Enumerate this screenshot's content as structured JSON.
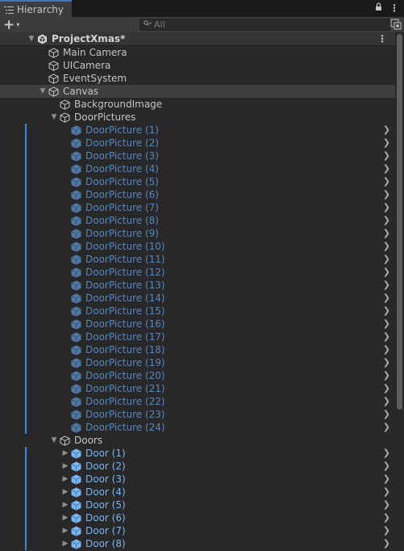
{
  "window": {
    "tab_label": "Hierarchy",
    "tab_icon": "hierarchy-list-icon",
    "lock_icon": "lock-icon",
    "menu_icon": "kebab-menu-icon"
  },
  "toolbar": {
    "add_button_label": "+",
    "add_button_caret": "▾",
    "search_placeholder": "All",
    "search_value": "",
    "scene_visibility_icon": "scene-visibility-icon"
  },
  "scene": {
    "name": "ProjectXmas*",
    "menu": "⋮"
  },
  "colors": {
    "prefab_blue": "#7cb4f0",
    "prefab_inactive": "#5b86b6",
    "prefab_bar": "#2a8be6",
    "tab_accent": "#3a79bb"
  },
  "tree": [
    {
      "label": "Main Camera",
      "depth": 1,
      "kind": "gameobject",
      "fold": "none"
    },
    {
      "label": "UICamera",
      "depth": 1,
      "kind": "gameobject",
      "fold": "none"
    },
    {
      "label": "EventSystem",
      "depth": 1,
      "kind": "gameobject",
      "fold": "none"
    },
    {
      "label": "Canvas",
      "depth": 1,
      "kind": "gameobject",
      "fold": "open",
      "hover": true
    },
    {
      "label": "BackgroundImage",
      "depth": 2,
      "kind": "gameobject",
      "fold": "none"
    },
    {
      "label": "DoorPictures",
      "depth": 2,
      "kind": "gameobject",
      "fold": "open"
    },
    {
      "label": "DoorPicture (1)",
      "depth": 3,
      "kind": "prefab-inactive",
      "fold": "none"
    },
    {
      "label": "DoorPicture (2)",
      "depth": 3,
      "kind": "prefab-inactive",
      "fold": "none"
    },
    {
      "label": "DoorPicture (3)",
      "depth": 3,
      "kind": "prefab-inactive",
      "fold": "none"
    },
    {
      "label": "DoorPicture (4)",
      "depth": 3,
      "kind": "prefab-inactive",
      "fold": "none"
    },
    {
      "label": "DoorPicture (5)",
      "depth": 3,
      "kind": "prefab-inactive",
      "fold": "none"
    },
    {
      "label": "DoorPicture (6)",
      "depth": 3,
      "kind": "prefab-inactive",
      "fold": "none"
    },
    {
      "label": "DoorPicture (7)",
      "depth": 3,
      "kind": "prefab-inactive",
      "fold": "none"
    },
    {
      "label": "DoorPicture (8)",
      "depth": 3,
      "kind": "prefab-inactive",
      "fold": "none"
    },
    {
      "label": "DoorPicture (9)",
      "depth": 3,
      "kind": "prefab-inactive",
      "fold": "none"
    },
    {
      "label": "DoorPicture (10)",
      "depth": 3,
      "kind": "prefab-inactive",
      "fold": "none"
    },
    {
      "label": "DoorPicture (11)",
      "depth": 3,
      "kind": "prefab-inactive",
      "fold": "none"
    },
    {
      "label": "DoorPicture (12)",
      "depth": 3,
      "kind": "prefab-inactive",
      "fold": "none"
    },
    {
      "label": "DoorPicture (13)",
      "depth": 3,
      "kind": "prefab-inactive",
      "fold": "none"
    },
    {
      "label": "DoorPicture (14)",
      "depth": 3,
      "kind": "prefab-inactive",
      "fold": "none"
    },
    {
      "label": "DoorPicture (15)",
      "depth": 3,
      "kind": "prefab-inactive",
      "fold": "none"
    },
    {
      "label": "DoorPicture (16)",
      "depth": 3,
      "kind": "prefab-inactive",
      "fold": "none"
    },
    {
      "label": "DoorPicture (17)",
      "depth": 3,
      "kind": "prefab-inactive",
      "fold": "none"
    },
    {
      "label": "DoorPicture (18)",
      "depth": 3,
      "kind": "prefab-inactive",
      "fold": "none"
    },
    {
      "label": "DoorPicture (19)",
      "depth": 3,
      "kind": "prefab-inactive",
      "fold": "none"
    },
    {
      "label": "DoorPicture (20)",
      "depth": 3,
      "kind": "prefab-inactive",
      "fold": "none"
    },
    {
      "label": "DoorPicture (21)",
      "depth": 3,
      "kind": "prefab-inactive",
      "fold": "none"
    },
    {
      "label": "DoorPicture (22)",
      "depth": 3,
      "kind": "prefab-inactive",
      "fold": "none"
    },
    {
      "label": "DoorPicture (23)",
      "depth": 3,
      "kind": "prefab-inactive",
      "fold": "none"
    },
    {
      "label": "DoorPicture (24)",
      "depth": 3,
      "kind": "prefab-inactive",
      "fold": "none"
    },
    {
      "label": "Doors",
      "depth": 2,
      "kind": "gameobject",
      "fold": "open"
    },
    {
      "label": "Door (1)",
      "depth": 3,
      "kind": "prefab",
      "fold": "closed"
    },
    {
      "label": "Door (2)",
      "depth": 3,
      "kind": "prefab",
      "fold": "closed"
    },
    {
      "label": "Door (3)",
      "depth": 3,
      "kind": "prefab",
      "fold": "closed"
    },
    {
      "label": "Door (4)",
      "depth": 3,
      "kind": "prefab",
      "fold": "closed"
    },
    {
      "label": "Door (5)",
      "depth": 3,
      "kind": "prefab",
      "fold": "closed"
    },
    {
      "label": "Door (6)",
      "depth": 3,
      "kind": "prefab",
      "fold": "closed"
    },
    {
      "label": "Door (7)",
      "depth": 3,
      "kind": "prefab",
      "fold": "closed"
    },
    {
      "label": "Door (8)",
      "depth": 3,
      "kind": "prefab",
      "fold": "closed"
    }
  ]
}
